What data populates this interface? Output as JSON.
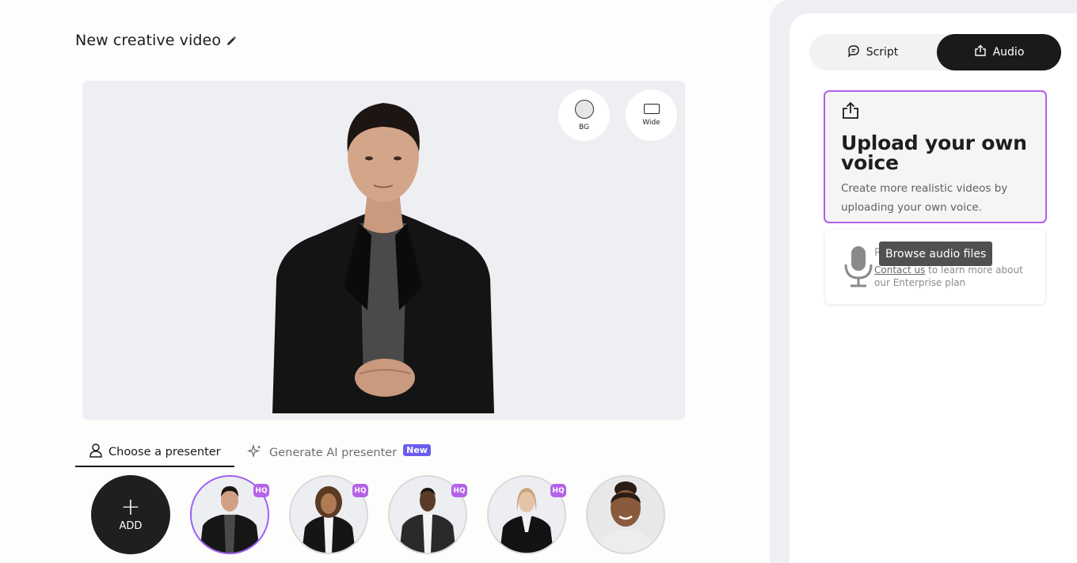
{
  "project": {
    "title": "New creative video"
  },
  "stage": {
    "bg_label": "BG",
    "wide_label": "Wide"
  },
  "presenter_tabs": {
    "choose_label": "Choose a presenter",
    "generate_label": "Generate AI presenter",
    "new_badge": "New"
  },
  "avatars": {
    "add_label": "ADD",
    "hq_label": "HQ",
    "items": [
      {
        "name": "presenter-1",
        "hq": true,
        "selected": true
      },
      {
        "name": "presenter-2",
        "hq": true,
        "selected": false
      },
      {
        "name": "presenter-3",
        "hq": true,
        "selected": false
      },
      {
        "name": "presenter-4",
        "hq": true,
        "selected": false
      },
      {
        "name": "presenter-5",
        "hq": false,
        "selected": false
      }
    ]
  },
  "right_panel": {
    "tabs": {
      "script_label": "Script",
      "audio_label": "Audio",
      "active": "Audio"
    },
    "upload_card": {
      "title": "Upload your own voice",
      "description": "Create more realistic videos by uploading your own voice."
    },
    "record_card": {
      "title_partial": "R",
      "link_text": "Contact us",
      "text": " to learn more about our Enterprise plan"
    },
    "tooltip": "Browse audio files"
  },
  "colors": {
    "accent": "#b45de8",
    "badge_new": "#6b5cf0",
    "dark": "#1a1a1a",
    "stage_bg": "#eeeff3"
  },
  "icons": [
    "pencil-icon",
    "user-icon",
    "sparkles-icon",
    "chat-icon",
    "upload-icon",
    "microphone-icon",
    "plus-icon"
  ]
}
